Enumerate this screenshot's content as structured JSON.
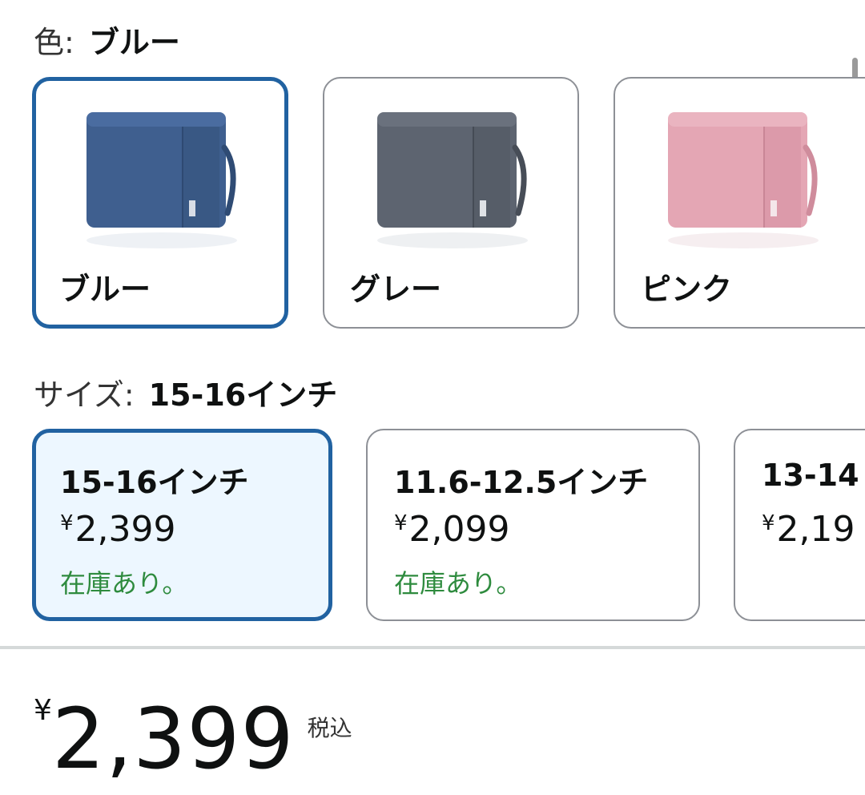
{
  "color_selector": {
    "label": "色:",
    "selected_value": "ブルー",
    "options": [
      {
        "name": "ブルー",
        "color": "#3f5f8f",
        "selected": true
      },
      {
        "name": "グレー",
        "color": "#5d6470",
        "selected": false
      },
      {
        "name": "ピンク",
        "color": "#e4a6b4",
        "selected": false
      }
    ]
  },
  "size_selector": {
    "label": "サイズ:",
    "selected_value": "15-16インチ",
    "options": [
      {
        "title": "15-16インチ",
        "currency": "¥",
        "price": "2,399",
        "stock": "在庫あり。",
        "selected": true
      },
      {
        "title": "11.6-12.5インチ",
        "currency": "¥",
        "price": "2,099",
        "stock": "在庫あり。",
        "selected": false
      },
      {
        "title": "13-14",
        "currency": "¥",
        "price": "2,19",
        "stock": "",
        "selected": false
      }
    ]
  },
  "price_block": {
    "currency": "¥",
    "amount": "2,399",
    "tax_note": "税込"
  },
  "colors": {
    "selected_border": "#2162a1",
    "selected_bg": "#edf7ff",
    "stock_green": "#2e8b3e",
    "border_gray": "#8d9096"
  }
}
